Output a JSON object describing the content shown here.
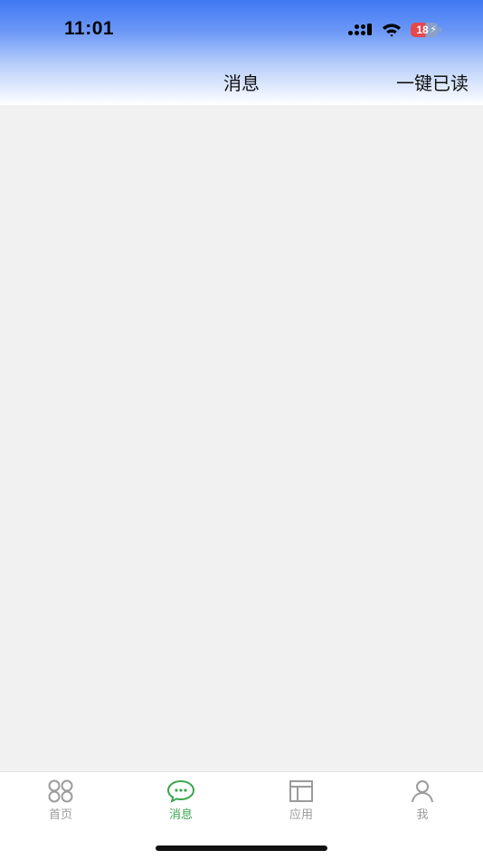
{
  "status_bar": {
    "time": "11:01",
    "battery_level": "18",
    "icons": [
      "cellular-signal-icon",
      "wifi-icon",
      "battery-charging-icon"
    ]
  },
  "nav": {
    "title": "消息",
    "action_label": "一键已读"
  },
  "tabbar": {
    "items": [
      {
        "label": "首页",
        "icon": "home-grid-icon",
        "active": false
      },
      {
        "label": "消息",
        "icon": "chat-bubble-icon",
        "active": true
      },
      {
        "label": "应用",
        "icon": "apps-layout-icon",
        "active": false
      },
      {
        "label": "我",
        "icon": "person-icon",
        "active": false
      }
    ]
  },
  "colors": {
    "header_gradient_top": "#3f78f3",
    "content_background": "#f1f1f1",
    "tab_active": "#3aa54a",
    "tab_inactive": "#9b9b9b"
  }
}
